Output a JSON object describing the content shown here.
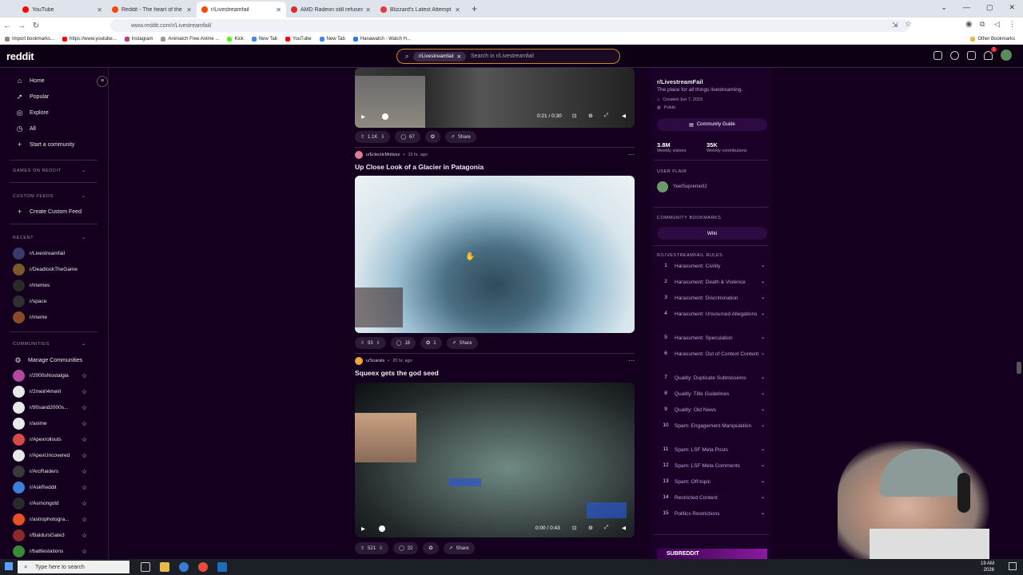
{
  "browser": {
    "tabs": [
      {
        "title": "YouTube",
        "color": "#ff0000"
      },
      {
        "title": "Reddit - The heart of the intern",
        "color": "#ff4500"
      },
      {
        "title": "r/Livestreamfail",
        "color": "#ff4500",
        "active": true
      },
      {
        "title": "AMD Radeon still refuses to ofi",
        "color": "#d32f2f"
      },
      {
        "title": "Blizzard's Latest Attempt at a S",
        "color": "#e53935"
      }
    ],
    "url": "www.reddit.com/r/Livestreamfail/",
    "bookmarks": [
      "Import bookmarks...",
      "https://www.youtube...",
      "Instagram",
      "Animatch Free Anime ...",
      "Kick",
      "New Tab",
      "YouTube",
      "New Tab",
      "Hanawatch - Watch H..."
    ],
    "other_bookmarks": "Other Bookmarks"
  },
  "header": {
    "logo": "reddit",
    "search_chip": "r/Livestreamfail",
    "search_placeholder": "Search in r/Livestreamfail",
    "notification_count": "1"
  },
  "sidebar": {
    "nav": [
      {
        "label": "Home",
        "icon": "home-icon"
      },
      {
        "label": "Popular",
        "icon": "popular-icon"
      },
      {
        "label": "Explore",
        "icon": "explore-icon"
      },
      {
        "label": "All",
        "icon": "all-icon"
      },
      {
        "label": "Start a community",
        "icon": "plus-icon"
      }
    ],
    "games_heading": "GAMES ON REDDIT",
    "custom_feeds_heading": "CUSTOM FEEDS",
    "create_feed": "Create Custom Feed",
    "recent_heading": "RECENT",
    "recent": [
      "r/Livestreamfail",
      "r/DeadlockTheGame",
      "r/memes",
      "r/space",
      "r/meme"
    ],
    "communities_heading": "COMMUNITIES",
    "manage": "Manage Communities",
    "communities": [
      "r/2000sNostalgia",
      "r/2meirl4meirl",
      "r/90sand2000s...",
      "r/anime",
      "r/Apexrollouts",
      "r/ApexUncovered",
      "r/ArcRaiders",
      "r/AskReddit",
      "r/Asmongold",
      "r/astrophotogra...",
      "r/BaldursGate3",
      "r/battlestations"
    ]
  },
  "posts": [
    {
      "video_time": "0:21 / 0:30",
      "votes": "1.1K",
      "comments": "67",
      "share": "Share"
    },
    {
      "author": "u/EclecticMotivez",
      "time": "15 hr. ago",
      "title": "Up Close Look of a Glacier in Patagonia",
      "votes": "93",
      "comments": "16",
      "awards": "1",
      "share": "Share"
    },
    {
      "author": "u/Soarals",
      "time": "20 hr. ago",
      "title": "Squeex gets the god seed",
      "video_time": "0:00 / 0:43",
      "votes": "521",
      "comments": "22",
      "share": "Share"
    }
  ],
  "community": {
    "name": "r/LivestreamFail",
    "description": "The place for all things livestreaming.",
    "created": "Created Jun 7, 2015",
    "visibility": "Public",
    "guide_button": "Community Guide",
    "visitors": "3.8M",
    "visitors_label": "Weekly visitors",
    "contributions": "35K",
    "contributions_label": "Weekly contributions",
    "user_flair_heading": "USER FLAIR",
    "user_flair": "YeetSupreme92",
    "bookmarks_heading": "COMMUNITY BOOKMARKS",
    "wiki": "Wiki",
    "rules_heading": "R/LIVESTREAMFAIL RULES",
    "rules": [
      "Harassment: Civility",
      "Harassment: Death & Violence",
      "Harassment: Discrimination",
      "Harassment: Unsourced Allegations",
      "Harassment: Speculation",
      "Harassment: Out of Context Content",
      "Quality: Duplicate Submissions",
      "Quality: Title Guidelines",
      "Quality: Old News",
      "Spam: Engagement Manipulation",
      "Spam: LSF Meta Posts",
      "Spam: LSF Meta Comments",
      "Spam: Off-topic",
      "Restricted Content",
      "Politics Restrictions"
    ]
  },
  "taskbar": {
    "search_placeholder": "Type here to search",
    "time": "19 AM",
    "date": "2026"
  }
}
